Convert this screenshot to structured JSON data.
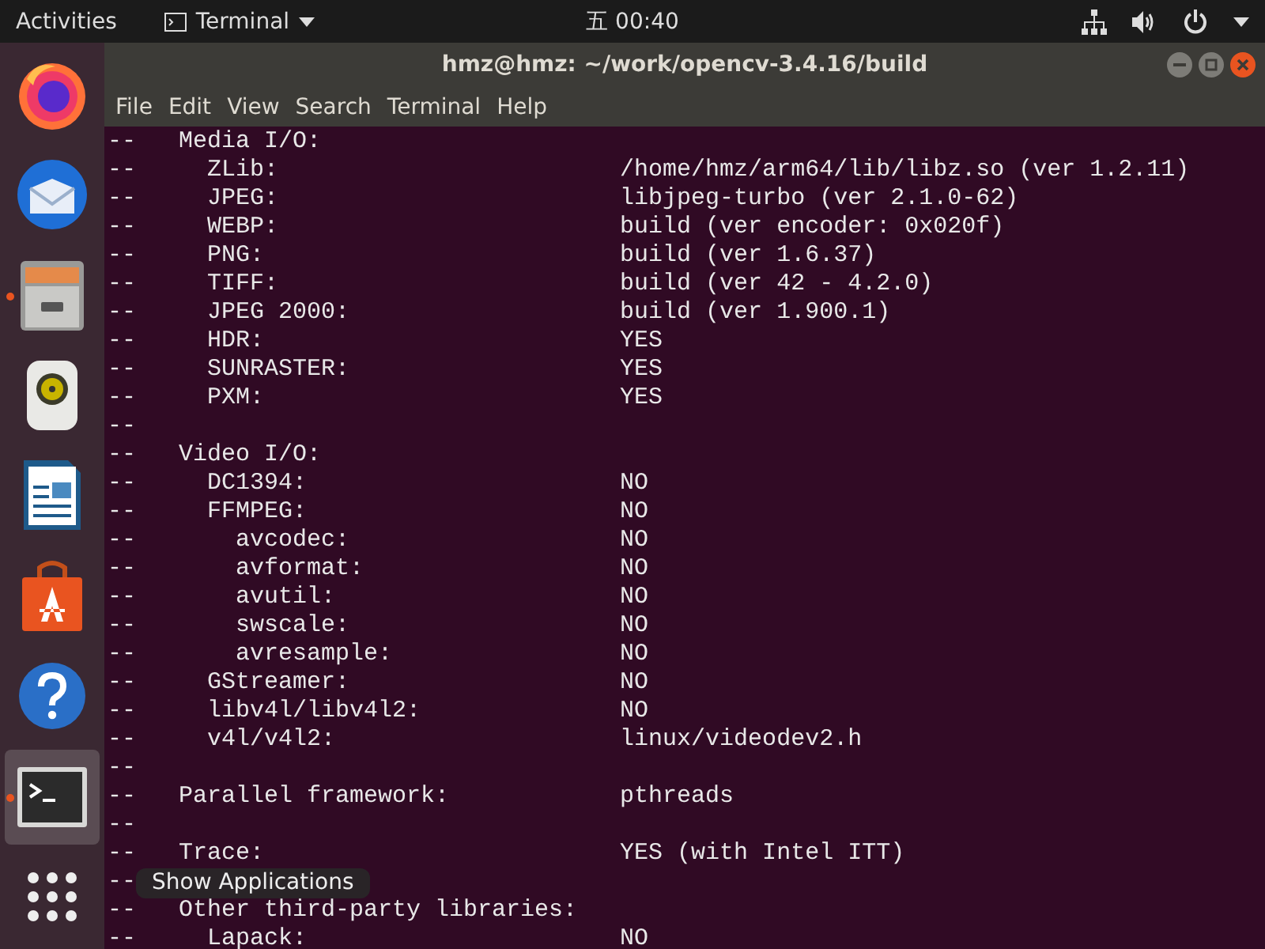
{
  "top_bar": {
    "activities": "Activities",
    "app_menu": "Terminal",
    "clock": "五 00:40"
  },
  "dock": {
    "items": [
      {
        "kind": "firefox",
        "running": false,
        "selected": false
      },
      {
        "kind": "mail",
        "running": false,
        "selected": false
      },
      {
        "kind": "files",
        "running": true,
        "selected": false
      },
      {
        "kind": "speaker",
        "running": false,
        "selected": false
      },
      {
        "kind": "document",
        "running": false,
        "selected": false
      },
      {
        "kind": "store",
        "running": false,
        "selected": false
      },
      {
        "kind": "help",
        "running": false,
        "selected": false
      },
      {
        "kind": "terminal",
        "running": true,
        "selected": true
      },
      {
        "kind": "apps",
        "running": false,
        "selected": false
      }
    ],
    "tooltip": "Show Applications"
  },
  "window": {
    "title": "hmz@hmz: ~/work/opencv-3.4.16/build",
    "menu": [
      "File",
      "Edit",
      "View",
      "Search",
      "Terminal",
      "Help"
    ]
  },
  "terminal": {
    "lines": [
      {
        "text": "--   Media I/O:"
      },
      {
        "text": "--     ZLib:",
        "value": "/home/hmz/arm64/lib/libz.so (ver 1.2.11)"
      },
      {
        "text": "--     JPEG:",
        "value": "libjpeg-turbo (ver 2.1.0-62)"
      },
      {
        "text": "--     WEBP:",
        "value": "build (ver encoder: 0x020f)"
      },
      {
        "text": "--     PNG:",
        "value": "build (ver 1.6.37)"
      },
      {
        "text": "--     TIFF:",
        "value": "build (ver 42 - 4.2.0)"
      },
      {
        "text": "--     JPEG 2000:",
        "value": "build (ver 1.900.1)"
      },
      {
        "text": "--     HDR:",
        "value": "YES"
      },
      {
        "text": "--     SUNRASTER:",
        "value": "YES"
      },
      {
        "text": "--     PXM:",
        "value": "YES"
      },
      {
        "text": "--"
      },
      {
        "text": "--   Video I/O:"
      },
      {
        "text": "--     DC1394:",
        "value": "NO"
      },
      {
        "text": "--     FFMPEG:",
        "value": "NO"
      },
      {
        "text": "--       avcodec:",
        "value": "NO"
      },
      {
        "text": "--       avformat:",
        "value": "NO"
      },
      {
        "text": "--       avutil:",
        "value": "NO"
      },
      {
        "text": "--       swscale:",
        "value": "NO"
      },
      {
        "text": "--       avresample:",
        "value": "NO"
      },
      {
        "text": "--     GStreamer:",
        "value": "NO"
      },
      {
        "text": "--     libv4l/libv4l2:",
        "value": "NO"
      },
      {
        "text": "--     v4l/v4l2:",
        "value": "linux/videodev2.h"
      },
      {
        "text": "--"
      },
      {
        "text": "--   Parallel framework:",
        "value": "pthreads"
      },
      {
        "text": "--"
      },
      {
        "text": "--   Trace:",
        "value": "YES (with Intel ITT)"
      },
      {
        "text": "--"
      },
      {
        "text": "--   Other third-party libraries:"
      },
      {
        "text": "--     Lapack:",
        "value": "NO"
      }
    ]
  }
}
